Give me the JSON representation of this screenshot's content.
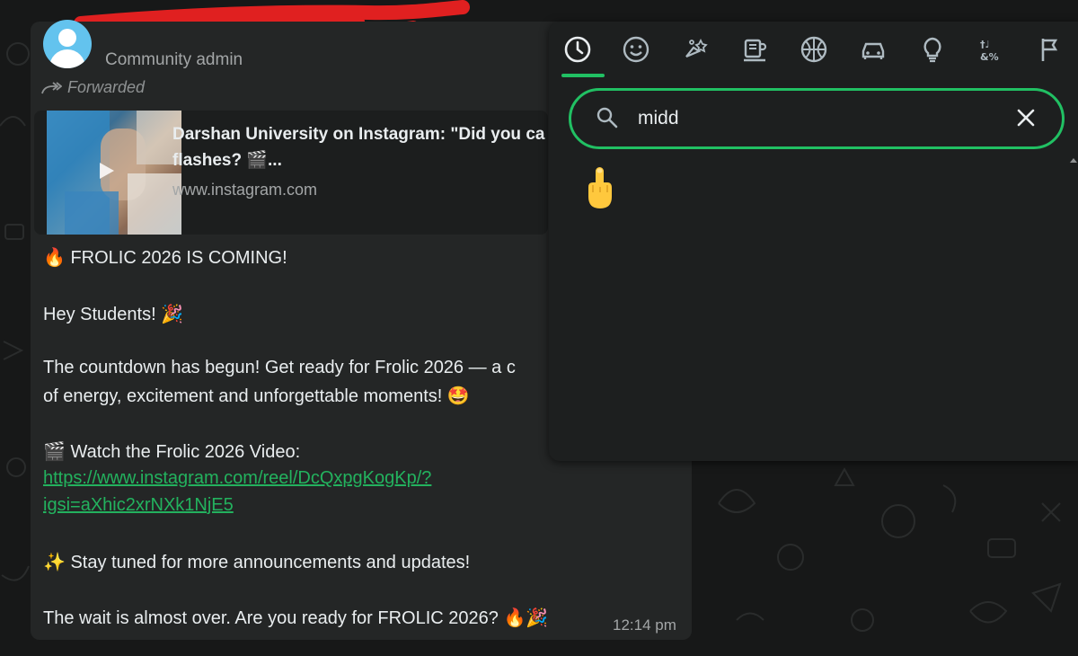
{
  "message": {
    "sender_role": "Community admin",
    "forwarded_label": "Forwarded",
    "link_preview": {
      "title_line1": "Darshan University on Instagram: \"Did you ca",
      "title_line2": "flashes? 🎬...",
      "domain": "www.instagram.com"
    },
    "lines": [
      "🔥 FROLIC 2026 IS COMING!",
      "Hey Students! 🎉",
      "The countdown has begun! Get ready for Frolic 2026 — a c",
      "of energy, excitement and unforgettable moments! 🤩",
      "🎬 Watch the Frolic 2026 Video:",
      "✨ Stay tuned for more announcements and updates!",
      "The wait is almost over. Are you ready for FROLIC 2026? 🔥🎉"
    ],
    "link_line1": "https://www.instagram.com/reel/DcQxpgKogKp/?",
    "link_line2": "igsi=aXhic2xrNXk1NjE5",
    "time": "12:14 pm"
  },
  "emoji_picker": {
    "tabs": [
      "recent",
      "smileys",
      "animals",
      "food",
      "activities",
      "travel",
      "objects",
      "symbols",
      "flags"
    ],
    "active_tab": "recent",
    "search_value": "midd",
    "results": [
      "🖕"
    ]
  },
  "colors": {
    "accent": "#21c063",
    "link": "#23b25e",
    "bubble": "#242626",
    "picker_bg": "#1d1f1f",
    "redaction": "#e02020"
  }
}
